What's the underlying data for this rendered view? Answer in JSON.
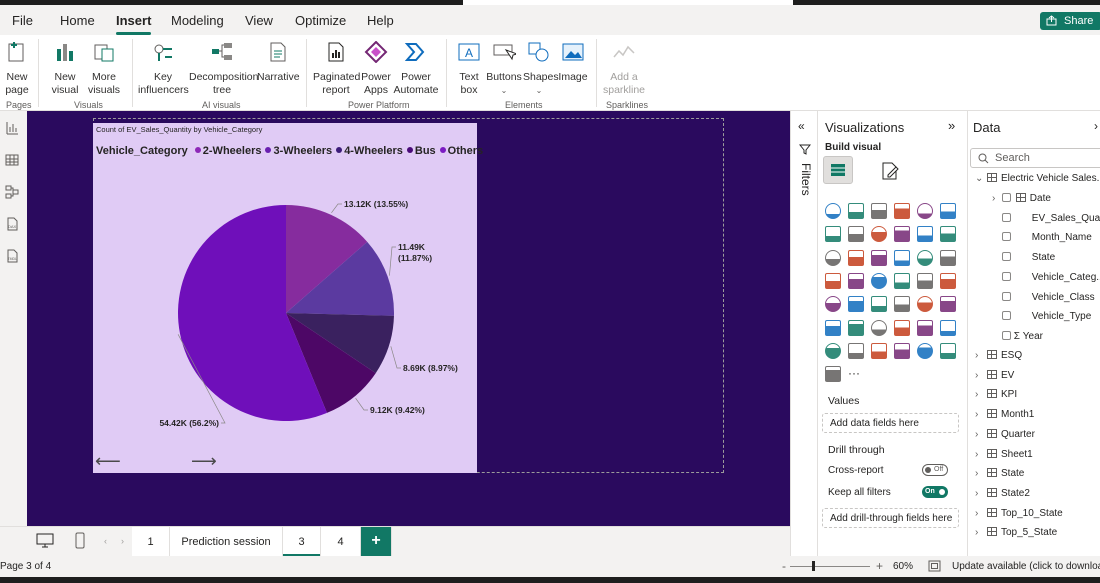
{
  "menu": {
    "items": [
      "File",
      "Home",
      "Insert",
      "Modeling",
      "View",
      "Optimize",
      "Help"
    ],
    "active": "Insert",
    "share_label": "Share"
  },
  "ribbon": {
    "pages": {
      "new_page": "New\npage",
      "group": "Pages"
    },
    "visuals": {
      "new_visual": "New\nvisual",
      "more_visuals": "More\nvisuals",
      "group": "Visuals"
    },
    "ai": {
      "key_influencers": "Key\ninfluencers",
      "decomposition": "Decomposition\ntree",
      "narrative": "Narrative",
      "group": "AI visuals"
    },
    "platform": {
      "paginated": "Paginated\nreport",
      "power_apps": "Power\nApps",
      "power_automate": "Power\nAutomate",
      "group": "Power Platform"
    },
    "elements": {
      "text_box": "Text\nbox",
      "buttons": "Buttons",
      "shapes": "Shapes",
      "image": "Image",
      "group": "Elements"
    },
    "sparklines": {
      "add": "Add a\nsparkline",
      "group": "Sparklines"
    }
  },
  "visual": {
    "title": "Count of EV_Sales_Quantity by Vehicle_Category",
    "legend_title": "Vehicle_Category",
    "legend": [
      "2-Wheelers",
      "3-Wheelers",
      "4-Wheelers",
      "Bus",
      "Others"
    ],
    "legend_colors": [
      "#8e28b8",
      "#6a1fb0",
      "#3d1c7a",
      "#4b0b7a",
      "#7b1bc2"
    ]
  },
  "chart_data": {
    "type": "pie",
    "title": "Count of EV_Sales_Quantity by Vehicle_Category",
    "legend_title": "Vehicle_Category",
    "slices": [
      {
        "label": "13.12K (13.55%)",
        "value": 13.12,
        "percent": 13.55,
        "color": "#862c9e"
      },
      {
        "label": "11.49K (11.87%)",
        "value": 11.49,
        "percent": 11.87,
        "color": "#5b3aa0"
      },
      {
        "label": "8.69K (8.97%)",
        "value": 8.69,
        "percent": 8.97,
        "color": "#3a215f"
      },
      {
        "label": "9.12K (9.42%)",
        "value": 9.12,
        "percent": 9.42,
        "color": "#4d0766"
      },
      {
        "label": "54.42K (56.2%)",
        "value": 54.42,
        "percent": 56.2,
        "color": "#6f0fba"
      }
    ]
  },
  "panes": {
    "filters_label": "Filters",
    "viz_title": "Visualizations",
    "build_visual": "Build visual",
    "values_label": "Values",
    "add_data_fields": "Add data fields here",
    "drill_through": "Drill through",
    "cross_report": "Cross-report",
    "cross_report_state": "Off",
    "keep_filters": "Keep all filters",
    "keep_filters_state": "On",
    "add_drill_fields": "Add drill-through fields here",
    "data_title": "Data",
    "search_placeholder": "Search"
  },
  "data_tree": {
    "root": "Electric Vehicle Sales...",
    "fields": [
      "Date",
      "EV_Sales_Qua...",
      "Month_Name",
      "State",
      "Vehicle_Categ...",
      "Vehicle_Class",
      "Vehicle_Type",
      "Year"
    ],
    "tables": [
      "ESQ",
      "EV",
      "KPI",
      "Month1",
      "Quarter",
      "Sheet1",
      "State",
      "State2",
      "Top_10_State",
      "Top_5_State"
    ]
  },
  "tabs": {
    "pages": [
      "1",
      "Prediction session",
      "3",
      "4"
    ],
    "active": "3",
    "add": "+"
  },
  "status": {
    "page": "Page 3 of 4",
    "zoom": "60%",
    "update": "Update available (click to download)"
  }
}
